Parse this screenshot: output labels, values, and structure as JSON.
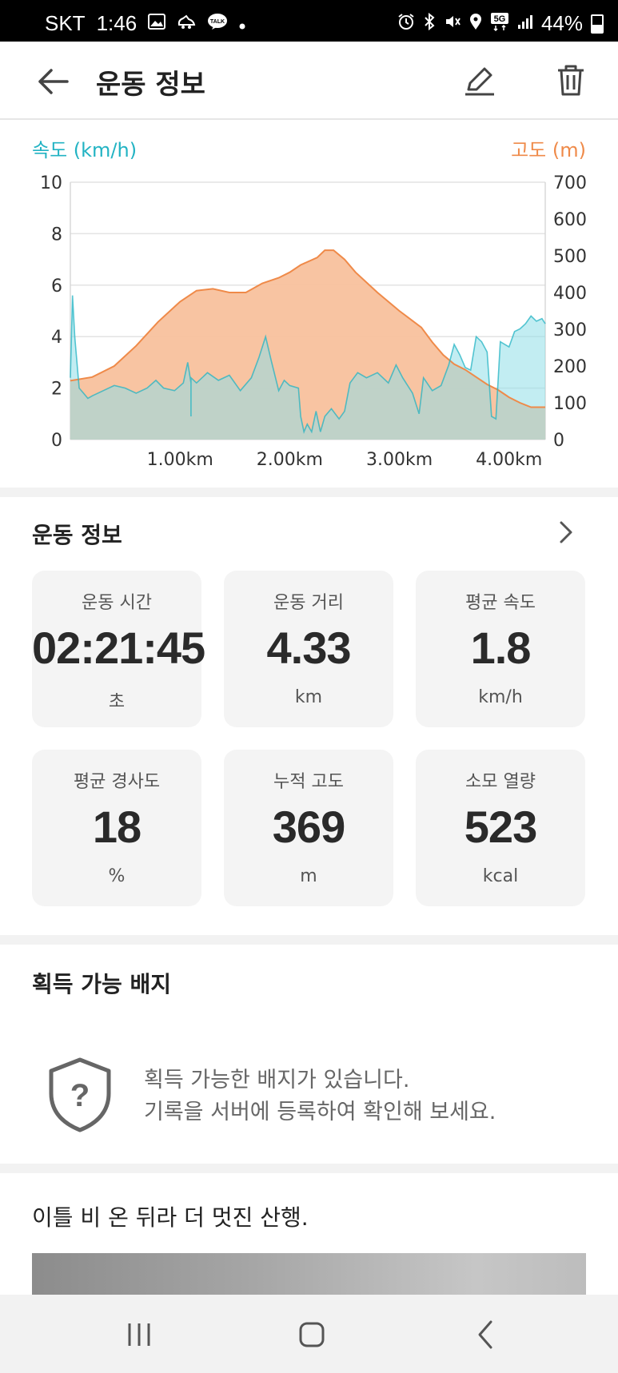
{
  "status_bar": {
    "carrier": "SKT",
    "time": "1:46",
    "left_icons": [
      "gallery-icon",
      "sneaker-icon",
      "talk-icon",
      "dot-icon"
    ],
    "right_icons": [
      "alarm-icon",
      "bluetooth-icon",
      "mute-icon",
      "location-icon",
      "5g-icon",
      "signal-icon"
    ],
    "network": "5G",
    "battery": "44%"
  },
  "appbar": {
    "title": "운동 정보",
    "back_icon": "arrow-left-icon",
    "edit_icon": "pencil-icon",
    "delete_icon": "trash-icon"
  },
  "colors": {
    "speed": "#22b3c3",
    "speed_fill": "#8fdfe8",
    "altitude": "#ef8a49",
    "altitude_fill": "#f8c19d",
    "overlap_fill": "#b5b08f"
  },
  "chart_data": {
    "type": "area",
    "y_left_label": "속도 (km/h)",
    "y_right_label": "고도 (m)",
    "y_left_range": [
      0,
      10
    ],
    "y_right_range": [
      0,
      700
    ],
    "y_left_ticks": [
      "0",
      "2",
      "4",
      "6",
      "8",
      "10"
    ],
    "y_right_ticks": [
      "0",
      "100",
      "200",
      "300",
      "400",
      "500",
      "600",
      "700"
    ],
    "x_range_km": [
      0,
      4.33
    ],
    "x_ticks": [
      "1.00km",
      "2.00km",
      "3.00km",
      "4.00km"
    ],
    "x_tick_values": [
      1,
      2,
      3,
      4
    ],
    "grid": true,
    "series": [
      {
        "name": "고도 (m)",
        "axis": "right",
        "points": [
          [
            0,
            160
          ],
          [
            0.2,
            170
          ],
          [
            0.4,
            200
          ],
          [
            0.6,
            255
          ],
          [
            0.8,
            320
          ],
          [
            1.0,
            375
          ],
          [
            1.15,
            405
          ],
          [
            1.3,
            410
          ],
          [
            1.45,
            400
          ],
          [
            1.6,
            400
          ],
          [
            1.75,
            425
          ],
          [
            1.9,
            440
          ],
          [
            2.0,
            455
          ],
          [
            2.1,
            475
          ],
          [
            2.25,
            495
          ],
          [
            2.32,
            515
          ],
          [
            2.4,
            515
          ],
          [
            2.5,
            490
          ],
          [
            2.6,
            455
          ],
          [
            2.8,
            400
          ],
          [
            3.0,
            350
          ],
          [
            3.2,
            305
          ],
          [
            3.3,
            265
          ],
          [
            3.4,
            230
          ],
          [
            3.5,
            205
          ],
          [
            3.6,
            190
          ],
          [
            3.7,
            170
          ],
          [
            3.8,
            150
          ],
          [
            3.9,
            135
          ],
          [
            4.0,
            115
          ],
          [
            4.1,
            100
          ],
          [
            4.2,
            88
          ],
          [
            4.33,
            88
          ]
        ]
      },
      {
        "name": "속도 (km/h)",
        "axis": "left",
        "points": [
          [
            0,
            2.4
          ],
          [
            0.02,
            5.6
          ],
          [
            0.04,
            4.0
          ],
          [
            0.08,
            2.0
          ],
          [
            0.12,
            1.8
          ],
          [
            0.16,
            1.6
          ],
          [
            0.2,
            1.7
          ],
          [
            0.3,
            1.9
          ],
          [
            0.4,
            2.1
          ],
          [
            0.5,
            2.0
          ],
          [
            0.6,
            1.8
          ],
          [
            0.7,
            2.0
          ],
          [
            0.78,
            2.3
          ],
          [
            0.85,
            2.0
          ],
          [
            0.95,
            1.9
          ],
          [
            1.03,
            2.2
          ],
          [
            1.07,
            3.0
          ],
          [
            1.1,
            2.2
          ],
          [
            1.1,
            0.9
          ],
          [
            1.1,
            2.4
          ],
          [
            1.15,
            2.2
          ],
          [
            1.25,
            2.6
          ],
          [
            1.35,
            2.3
          ],
          [
            1.45,
            2.5
          ],
          [
            1.55,
            1.9
          ],
          [
            1.65,
            2.4
          ],
          [
            1.72,
            3.2
          ],
          [
            1.78,
            4.0
          ],
          [
            1.83,
            3.1
          ],
          [
            1.9,
            1.9
          ],
          [
            1.95,
            2.3
          ],
          [
            2.0,
            2.1
          ],
          [
            2.08,
            2.0
          ],
          [
            2.1,
            0.9
          ],
          [
            2.13,
            0.3
          ],
          [
            2.16,
            0.6
          ],
          [
            2.2,
            0.3
          ],
          [
            2.24,
            1.1
          ],
          [
            2.28,
            0.3
          ],
          [
            2.32,
            0.9
          ],
          [
            2.38,
            1.2
          ],
          [
            2.45,
            0.8
          ],
          [
            2.5,
            1.1
          ],
          [
            2.55,
            2.2
          ],
          [
            2.62,
            2.6
          ],
          [
            2.7,
            2.4
          ],
          [
            2.8,
            2.6
          ],
          [
            2.9,
            2.2
          ],
          [
            2.97,
            2.9
          ],
          [
            3.03,
            2.4
          ],
          [
            3.12,
            1.8
          ],
          [
            3.18,
            1.0
          ],
          [
            3.22,
            2.4
          ],
          [
            3.3,
            1.9
          ],
          [
            3.38,
            2.1
          ],
          [
            3.45,
            2.9
          ],
          [
            3.5,
            3.7
          ],
          [
            3.55,
            3.3
          ],
          [
            3.6,
            2.8
          ],
          [
            3.65,
            2.7
          ],
          [
            3.7,
            4.0
          ],
          [
            3.75,
            3.8
          ],
          [
            3.8,
            3.4
          ],
          [
            3.84,
            0.9
          ],
          [
            3.88,
            0.8
          ],
          [
            3.92,
            3.8
          ],
          [
            4.0,
            3.6
          ],
          [
            4.05,
            4.2
          ],
          [
            4.1,
            4.3
          ],
          [
            4.15,
            4.5
          ],
          [
            4.2,
            4.8
          ],
          [
            4.25,
            4.6
          ],
          [
            4.3,
            4.7
          ],
          [
            4.33,
            4.5
          ]
        ]
      }
    ]
  },
  "workout_info": {
    "header": "운동 정보",
    "chevron_icon": "chevron-right-icon",
    "stats": [
      {
        "label": "운동 시간",
        "value": "02:21:45",
        "unit": "초"
      },
      {
        "label": "운동 거리",
        "value": "4.33",
        "unit": "km"
      },
      {
        "label": "평균 속도",
        "value": "1.8",
        "unit": "km/h"
      },
      {
        "label": "평균 경사도",
        "value": "18",
        "unit": "%"
      },
      {
        "label": "누적 고도",
        "value": "369",
        "unit": "m"
      },
      {
        "label": "소모 열량",
        "value": "523",
        "unit": "kcal"
      }
    ]
  },
  "badges": {
    "header": "획득 가능 배지",
    "icon": "shield-question-icon",
    "message_line1": "획득 가능한 배지가 있습니다.",
    "message_line2": "기록을 서버에 등록하여 확인해 보세요."
  },
  "post": {
    "text": "이틀 비 온 뒤라 더 멋진 산행."
  },
  "nav": {
    "recents_icon": "recents-icon",
    "home_icon": "home-icon",
    "back_icon": "nav-back-icon"
  }
}
